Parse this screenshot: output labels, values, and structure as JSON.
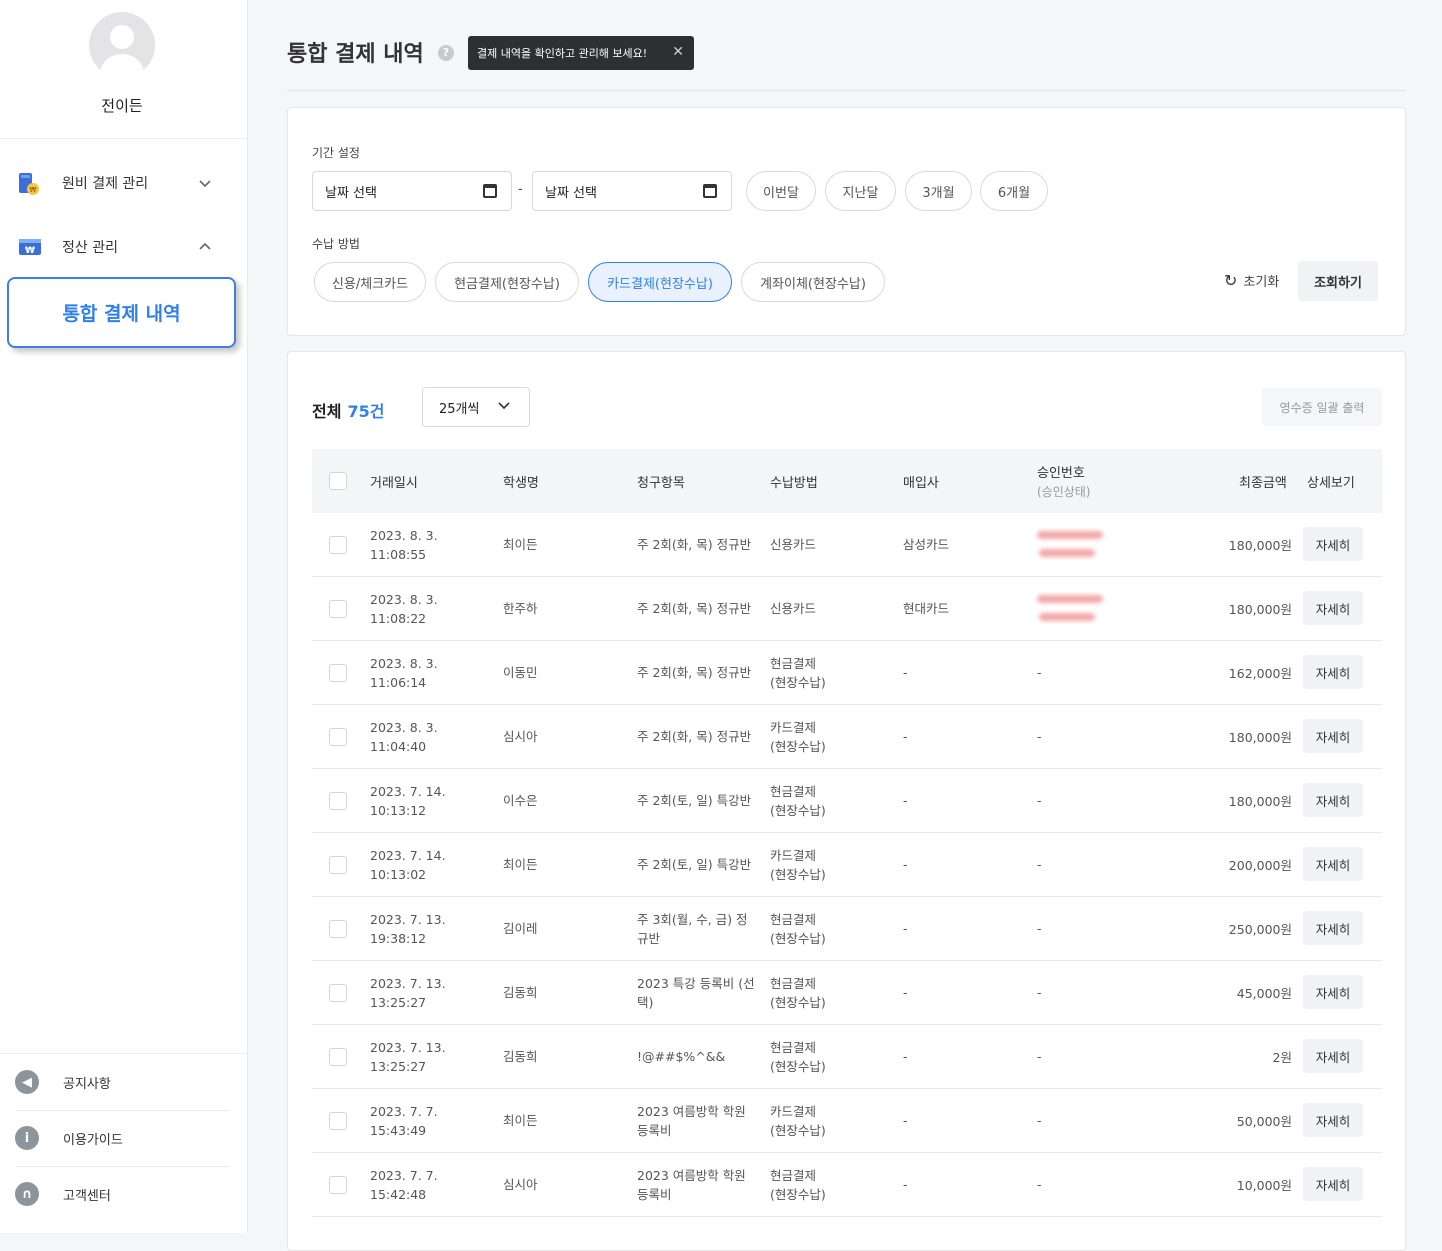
{
  "sidebar": {
    "username": "전이든",
    "menus": [
      {
        "label": "원비 결제 관리",
        "icon": "tuition-icon",
        "expanded": false
      },
      {
        "label": "정산 관리",
        "icon": "settlement-icon",
        "expanded": true
      }
    ],
    "active_item": "통합 결제 내역",
    "bottom": [
      {
        "label": "공지사항",
        "icon": "megaphone-icon"
      },
      {
        "label": "이용가이드",
        "icon": "info-icon"
      },
      {
        "label": "고객센터",
        "icon": "headset-icon"
      }
    ]
  },
  "header": {
    "title": "통합 결제 내역",
    "help": "?",
    "tooltip": "결제 내역을 확인하고 관리해 보세요!",
    "tooltip_close": "✕"
  },
  "filter": {
    "period_label": "기간 설정",
    "start_placeholder": "날짜 선택",
    "end_placeholder": "날짜 선택",
    "dash": "-",
    "quick_ranges": [
      "이번달",
      "지난달",
      "3개월",
      "6개월"
    ],
    "method_label": "수납 방법",
    "methods": [
      "신용/체크카드",
      "현금결제(현장수납)",
      "카드결제(현장수납)",
      "계좌이체(현장수납)"
    ],
    "active_method": "카드결제(현장수납)",
    "reset_label": "초기화",
    "search_label": "조회하기"
  },
  "list": {
    "total_label": "전체",
    "total_count": "75건",
    "per_page": "25개씩",
    "receipt_button": "영수증 일괄 출력",
    "columns": {
      "datetime": "거래일시",
      "student": "학생명",
      "item": "청구항목",
      "method": "수납방법",
      "acquirer": "매입사",
      "approval": "승인번호",
      "approval_sub": "(승인상태)",
      "amount": "최종금액",
      "detail": "상세보기"
    },
    "rows": [
      {
        "date": "2023. 8. 3.",
        "time": "11:08:55",
        "student": "최이든",
        "item1": "주 2회(화, 목) 정규반",
        "item2": "",
        "method1": "신용카드",
        "method2": "",
        "acquirer": "삼성카드",
        "approval": "",
        "amount": "180,000원",
        "detail": "자세히"
      },
      {
        "date": "2023. 8. 3.",
        "time": "11:08:22",
        "student": "한주하",
        "item1": "주 2회(화, 목) 정규반",
        "item2": "",
        "method1": "신용카드",
        "method2": "",
        "acquirer": "현대카드",
        "approval": "",
        "amount": "180,000원",
        "detail": "자세히"
      },
      {
        "date": "2023. 8. 3.",
        "time": "11:06:14",
        "student": "이동민",
        "item1": "주 2회(화, 목) 정규반",
        "item2": "",
        "method1": "현금결제",
        "method2": "(현장수납)",
        "acquirer": "-",
        "approval": "-",
        "amount": "162,000원",
        "detail": "자세히"
      },
      {
        "date": "2023. 8. 3.",
        "time": "11:04:40",
        "student": "심시아",
        "item1": "주 2회(화, 목) 정규반",
        "item2": "",
        "method1": "카드결제",
        "method2": "(현장수납)",
        "acquirer": "-",
        "approval": "-",
        "amount": "180,000원",
        "detail": "자세히"
      },
      {
        "date": "2023. 7. 14.",
        "time": "10:13:12",
        "student": "이수은",
        "item1": "주 2회(토, 일) 특강반",
        "item2": "",
        "method1": "현금결제",
        "method2": "(현장수납)",
        "acquirer": "-",
        "approval": "-",
        "amount": "180,000원",
        "detail": "자세히"
      },
      {
        "date": "2023. 7. 14.",
        "time": "10:13:02",
        "student": "최이든",
        "item1": "주 2회(토, 일) 특강반",
        "item2": "",
        "method1": "카드결제",
        "method2": "(현장수납)",
        "acquirer": "-",
        "approval": "-",
        "amount": "200,000원",
        "detail": "자세히"
      },
      {
        "date": "2023. 7. 13.",
        "time": "19:38:12",
        "student": "김이레",
        "item1": "주 3회(월, 수, 금) 정",
        "item2": "규반",
        "method1": "현금결제",
        "method2": "(현장수납)",
        "acquirer": "-",
        "approval": "-",
        "amount": "250,000원",
        "detail": "자세히"
      },
      {
        "date": "2023. 7. 13.",
        "time": "13:25:27",
        "student": "김동희",
        "item1": "2023 특강 등록비 (선",
        "item2": "택)",
        "method1": "현금결제",
        "method2": "(현장수납)",
        "acquirer": "-",
        "approval": "-",
        "amount": "45,000원",
        "detail": "자세히"
      },
      {
        "date": "2023. 7. 13.",
        "time": "13:25:27",
        "student": "김동희",
        "item1": "!@##$%^&&",
        "item2": "",
        "method1": "현금결제",
        "method2": "(현장수납)",
        "acquirer": "-",
        "approval": "-",
        "amount": "2원",
        "detail": "자세히"
      },
      {
        "date": "2023. 7. 7.",
        "time": "15:43:49",
        "student": "최이든",
        "item1": "2023 여름방학 학원",
        "item2": "등록비",
        "method1": "카드결제",
        "method2": "(현장수납)",
        "acquirer": "-",
        "approval": "-",
        "amount": "50,000원",
        "detail": "자세히"
      },
      {
        "date": "2023. 7. 7.",
        "time": "15:42:48",
        "student": "심시아",
        "item1": "2023 여름방학 학원",
        "item2": "등록비",
        "method1": "현금결제",
        "method2": "(현장수납)",
        "acquirer": "-",
        "approval": "-",
        "amount": "10,000원",
        "detail": "자세히"
      }
    ]
  },
  "colors": {
    "accent": "#2f80ed",
    "tooltip_bg": "#2d2f33",
    "blur_mask": "#f3a8a8"
  }
}
